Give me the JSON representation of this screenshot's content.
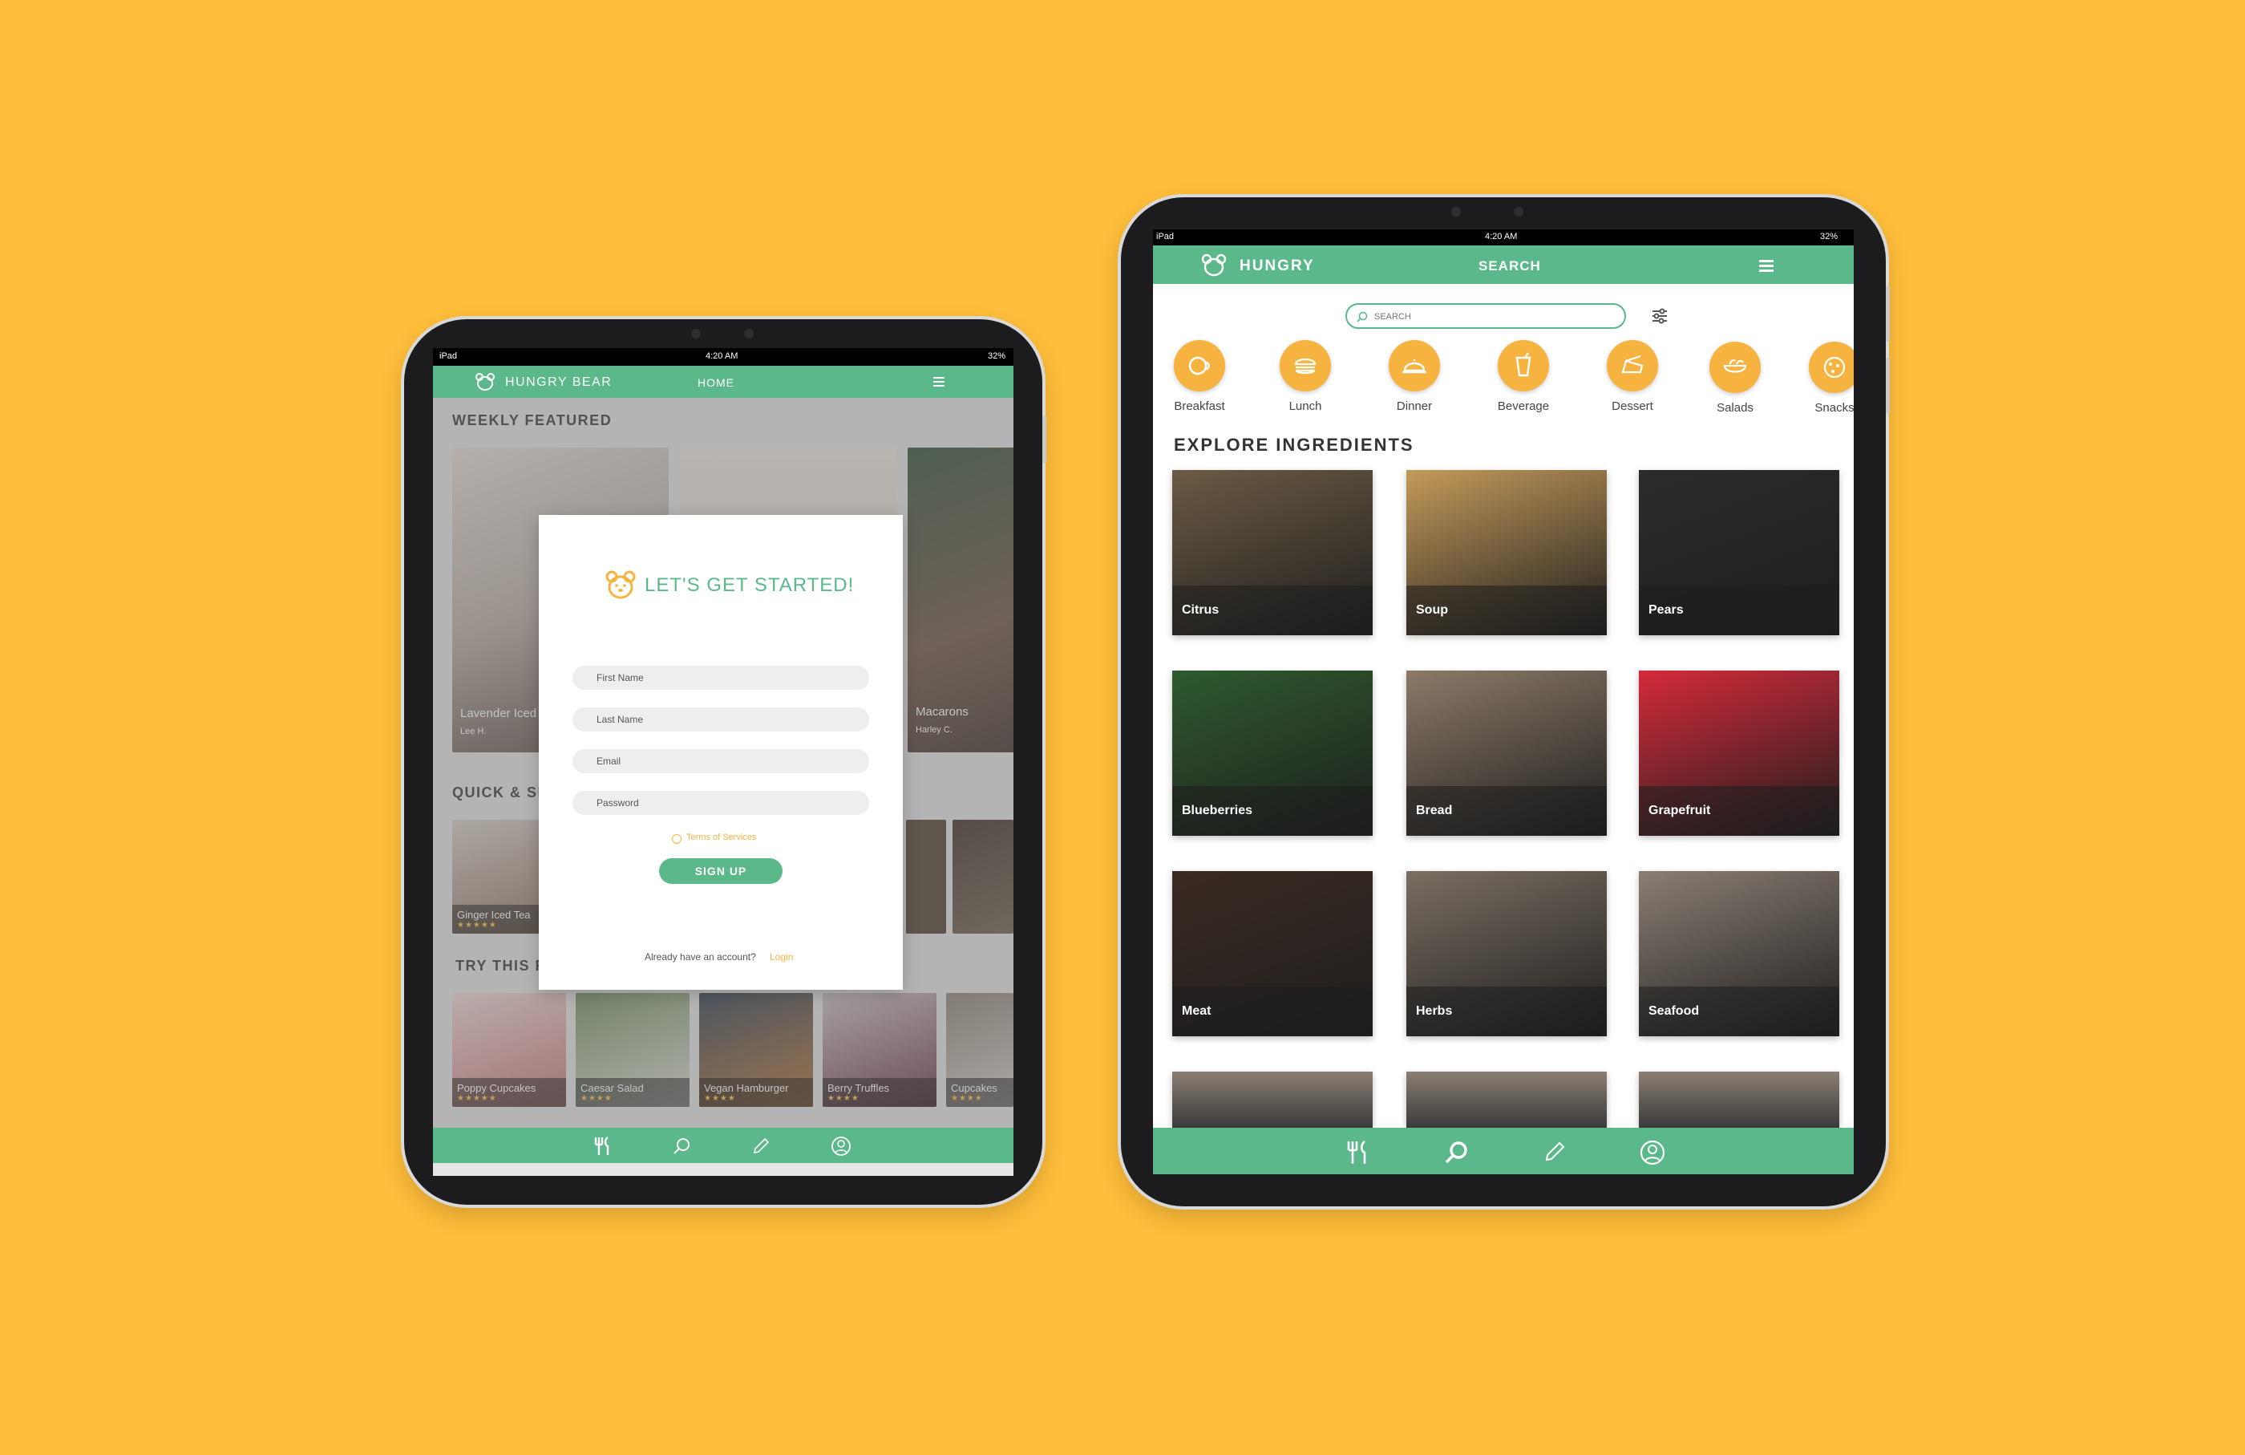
{
  "colors": {
    "background": "#FEBD3A",
    "accent_green": "#5BB88A",
    "accent_orange": "#F7B33F"
  },
  "left_tablet": {
    "status": {
      "carrier": "iPad",
      "time": "4:20 AM",
      "battery": "32%"
    },
    "nav": {
      "brand": "HUNGRY BEAR",
      "title": "HOME",
      "menu_icon": "hamburger-icon"
    },
    "weekly_featured": {
      "title": "WEEKLY FEATURED",
      "items": [
        {
          "name": "Lavender Iced",
          "author": "Lee H."
        },
        {
          "name": "",
          "author": ""
        },
        {
          "name": "Macarons",
          "author": "Harley C."
        }
      ]
    },
    "quick": {
      "title": "QUICK & SIM",
      "items": [
        {
          "name": "Ginger Iced Tea",
          "stars": "★★★★★"
        }
      ]
    },
    "try_this": {
      "title": "TRY THIS R",
      "items": [
        {
          "name": "Poppy Cupcakes",
          "stars": "★★★★★"
        },
        {
          "name": "Caesar Salad",
          "stars": "★★★★"
        },
        {
          "name": "Vegan Hamburger",
          "stars": "★★★★"
        },
        {
          "name": "Berry Truffles",
          "stars": "★★★★"
        },
        {
          "name": "Cupcakes",
          "stars": "★★★★"
        }
      ]
    },
    "modal": {
      "title": "LET'S GET STARTED!",
      "fields": {
        "first_name": "First Name",
        "last_name": "Last Name",
        "email": "Email",
        "password": "Password"
      },
      "terms": "Terms of Services",
      "signup": "SIGN UP",
      "already": "Already have an account?",
      "login": "Login"
    }
  },
  "right_tablet": {
    "status": {
      "carrier": "iPad",
      "time": "4:20 AM",
      "battery": "32%"
    },
    "nav": {
      "brand": "HUNGRY",
      "title": "SEARCH",
      "menu_icon": "hamburger-icon"
    },
    "search": {
      "placeholder": "SEARCH"
    },
    "categories": [
      {
        "label": "Breakfast",
        "icon": "breakfast-icon"
      },
      {
        "label": "Lunch",
        "icon": "lunch-icon"
      },
      {
        "label": "Dinner",
        "icon": "dinner-icon"
      },
      {
        "label": "Beverage",
        "icon": "beverage-icon"
      },
      {
        "label": "Dessert",
        "icon": "dessert-icon"
      },
      {
        "label": "Salads",
        "icon": "salads-icon"
      },
      {
        "label": "Snacks",
        "icon": "snacks-icon"
      }
    ],
    "explore": {
      "title": "EXPLORE INGREDIENTS",
      "items": [
        {
          "label": "Citrus",
          "color": "#6b5a44"
        },
        {
          "label": "Soup",
          "color": "#c49a5a"
        },
        {
          "label": "Pears",
          "color": "#2b2b2b"
        },
        {
          "label": "Blueberries",
          "color": "#2e5a2e"
        },
        {
          "label": "Bread",
          "color": "#8c7a68"
        },
        {
          "label": "Grapefruit",
          "color": "#d42a3a"
        },
        {
          "label": "Meat",
          "color": "#3a2a22"
        },
        {
          "label": "Herbs",
          "color": "#7a6e62"
        },
        {
          "label": "Seafood",
          "color": "#8a7e74"
        }
      ]
    }
  }
}
